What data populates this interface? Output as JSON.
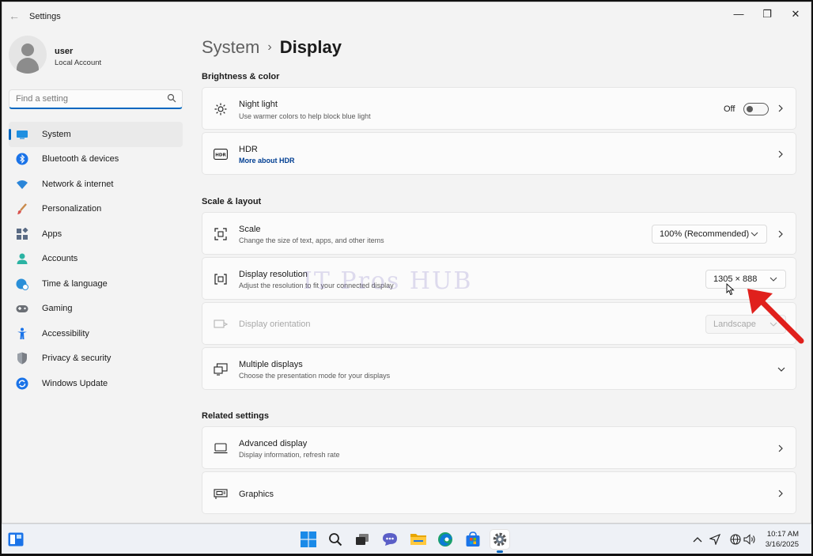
{
  "window": {
    "title": "Settings",
    "controls": {
      "minimize": "—",
      "maximize": "❐",
      "close": "✕"
    }
  },
  "profile": {
    "name": "user",
    "role": "Local Account"
  },
  "search": {
    "placeholder": "Find a setting"
  },
  "sidebar": {
    "items": [
      {
        "label": "System",
        "icon": "monitor-icon",
        "active": true
      },
      {
        "label": "Bluetooth & devices",
        "icon": "bluetooth-icon"
      },
      {
        "label": "Network & internet",
        "icon": "wifi-icon"
      },
      {
        "label": "Personalization",
        "icon": "brush-icon"
      },
      {
        "label": "Apps",
        "icon": "apps-icon"
      },
      {
        "label": "Accounts",
        "icon": "person-icon"
      },
      {
        "label": "Time & language",
        "icon": "globe-clock-icon"
      },
      {
        "label": "Gaming",
        "icon": "gamepad-icon"
      },
      {
        "label": "Accessibility",
        "icon": "accessibility-icon"
      },
      {
        "label": "Privacy & security",
        "icon": "shield-icon"
      },
      {
        "label": "Windows Update",
        "icon": "update-icon"
      }
    ]
  },
  "breadcrumb": {
    "parent": "System",
    "separator": "›",
    "current": "Display"
  },
  "sections": {
    "brightness": "Brightness & color",
    "scale_layout": "Scale & layout",
    "related": "Related settings"
  },
  "night_light": {
    "title": "Night light",
    "subtitle": "Use warmer colors to help block blue light",
    "state_label": "Off"
  },
  "hdr": {
    "title": "HDR",
    "link": "More about HDR"
  },
  "scale": {
    "title": "Scale",
    "subtitle": "Change the size of text, apps, and other items",
    "value": "100% (Recommended)"
  },
  "resolution": {
    "title": "Display resolution",
    "subtitle": "Adjust the resolution to fit your connected display",
    "value": "1305 × 888"
  },
  "orientation": {
    "title": "Display orientation",
    "value": "Landscape"
  },
  "multiple_displays": {
    "title": "Multiple displays",
    "subtitle": "Choose the presentation mode for your displays"
  },
  "advanced_display": {
    "title": "Advanced display",
    "subtitle": "Display information, refresh rate"
  },
  "graphics": {
    "title": "Graphics"
  },
  "watermark": "IT Pros HUB",
  "colors": {
    "accent": "#0067c0",
    "annotation_arrow": "#e0201c"
  },
  "taskbar": {
    "time": "10:17 AM",
    "date": "3/16/2025",
    "apps": [
      "start-icon",
      "search-icon",
      "task-view-icon",
      "chat-icon",
      "file-explorer-icon",
      "edge-icon",
      "store-icon",
      "settings-icon"
    ]
  }
}
